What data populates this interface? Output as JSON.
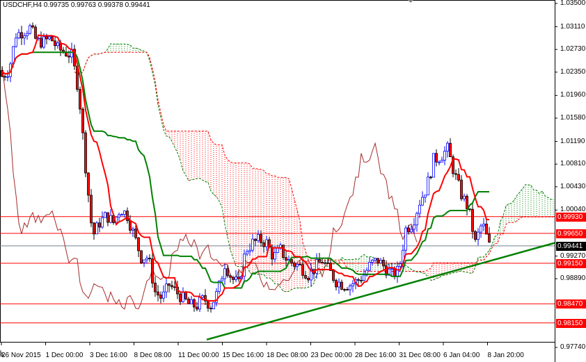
{
  "header": {
    "symbol": "USDCHF,H4",
    "ohlc": "0.99735 0.99763 0.99378 0.99441"
  },
  "colors": {
    "bull": "#0000ff",
    "bear": "#ff0000",
    "tenkan": "#ff0000",
    "kijun": "#008000",
    "chikou": "#a52a2a",
    "cloud_up": "#008000",
    "cloud_down": "#ff0000",
    "hline": "#ff0000",
    "trendline": "#008000",
    "current": "#000000"
  },
  "chart_data": {
    "type": "candlestick",
    "title": "USDCHF,H4",
    "ylim": [
      0.9774,
      1.035
    ],
    "y_ticks": [
      "1.03500",
      "1.03110",
      "1.02730",
      "1.02350",
      "1.01960",
      "1.01580",
      "1.01190",
      "1.00810",
      "1.00430",
      "1.00040",
      "0.99270",
      "0.98890",
      "0.97740"
    ],
    "x_ticks": [
      "26 Nov 2015",
      "1 Dec 00:00",
      "3 Dec 16:00",
      "8 Dec 08:00",
      "11 Dec 00:00",
      "15 Dec 16:00",
      "18 Dec 08:00",
      "23 Dec 00:00",
      "28 Dec 16:00",
      "31 Dec 08:00",
      "6 Jan 04:00",
      "8 Jan 20:00"
    ],
    "closes_approx": [
      1.0228,
      1.0239,
      1.0298,
      1.0303,
      1.0309,
      1.0286,
      1.0286,
      1.0292,
      1.0274,
      1.0269,
      1.0263,
      1.0205,
      1.0077,
      0.996,
      0.9983,
      0.9995,
      0.9983,
      1.0007,
      0.9995,
      0.996,
      0.9925,
      0.9925,
      0.9867,
      0.9856,
      0.9879,
      0.9867,
      0.9856,
      0.9844,
      0.9844,
      0.9856,
      0.9844,
      0.9867,
      0.9914,
      0.989,
      0.9879,
      0.9937,
      0.9949,
      0.9954,
      0.9949,
      0.9925,
      0.9937,
      0.992,
      0.9914,
      0.9908,
      0.9896,
      0.9908,
      0.992,
      0.9902,
      0.9885,
      0.9879,
      0.9879,
      0.9885,
      0.9896,
      0.9914,
      0.992,
      0.9908,
      0.9896,
      0.9902,
      0.9972,
      0.9983,
      1.0018,
      1.0042,
      1.0088,
      1.0094,
      1.0106,
      1.0065,
      1.003,
      1.0007,
      0.9949,
      0.9983,
      0.9944
    ],
    "horizontal_levels": [
      {
        "label": "0.99930",
        "value": 0.9993,
        "color": "#ff0000"
      },
      {
        "label": "0.99650",
        "value": 0.9965,
        "color": "#ff0000"
      },
      {
        "label": "0.99441",
        "value": 0.99441,
        "color": "#000000"
      },
      {
        "label": "0.99150",
        "value": 0.9915,
        "color": "#ff0000"
      },
      {
        "label": "0.98470",
        "value": 0.9847,
        "color": "#ff0000"
      },
      {
        "label": "0.98150",
        "value": 0.9815,
        "color": "#ff0000"
      }
    ],
    "trendline": {
      "start_price": 0.9787,
      "end_price": 0.9949,
      "start_index": 29,
      "end_index": 79
    },
    "indicators": [
      "Ichimoku Kinko Hyo (9,26,52)"
    ]
  }
}
